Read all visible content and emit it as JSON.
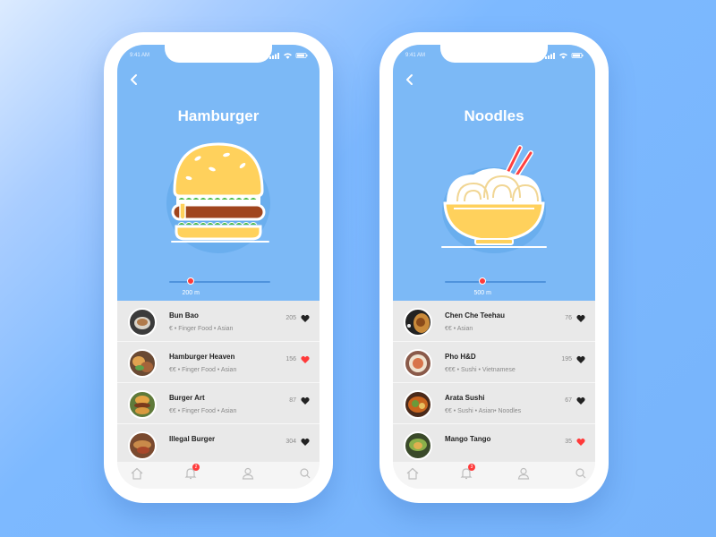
{
  "screens": [
    {
      "status_time": "9:41 AM",
      "title": "Hamburger",
      "illustration": "hamburger-illustration",
      "slider": {
        "label": "200 m",
        "value_fraction": 0.21
      },
      "restaurants": [
        {
          "name": "Bun Bao",
          "meta": "€ • Finger Food • Asian",
          "count": "205",
          "liked": false
        },
        {
          "name": "Hamburger Heaven",
          "meta": "€€ • Finger Food • Asian",
          "count": "156",
          "liked": true
        },
        {
          "name": "Burger Art",
          "meta": "€€ • Finger Food • Asian",
          "count": "87",
          "liked": false
        },
        {
          "name": "Illegal Burger",
          "meta": "",
          "count": "304",
          "liked": false
        }
      ],
      "tabbar": {
        "notification_count": "2"
      }
    },
    {
      "status_time": "9:41 AM",
      "title": "Noodles",
      "illustration": "noodle-bowl-illustration",
      "slider": {
        "label": "500 m",
        "value_fraction": 0.37
      },
      "restaurants": [
        {
          "name": "Chen Che Teehau",
          "meta": "€€ • Asian",
          "count": "76",
          "liked": false
        },
        {
          "name": "Pho H&D",
          "meta": "€€€ • Sushi • Vietnamese",
          "count": "195",
          "liked": false
        },
        {
          "name": "Arata Sushi",
          "meta": "€€ • Sushi • Asian• Noodles",
          "count": "67",
          "liked": false
        },
        {
          "name": "Mango Tango",
          "meta": "",
          "count": "35",
          "liked": true
        }
      ],
      "tabbar": {
        "notification_count": "3"
      }
    }
  ],
  "colors": {
    "hero_background": "#7cb9f6",
    "page_background": "#77b4fb",
    "accent_red": "#ff3a3a",
    "list_background": "#e9e9e9"
  },
  "icons": {
    "back": "chevron-left-icon",
    "liked": "heart-filled-red-icon",
    "not_liked": "heart-filled-black-icon",
    "tabs": [
      "home-icon",
      "bell-icon",
      "user-icon",
      "search-icon"
    ]
  }
}
